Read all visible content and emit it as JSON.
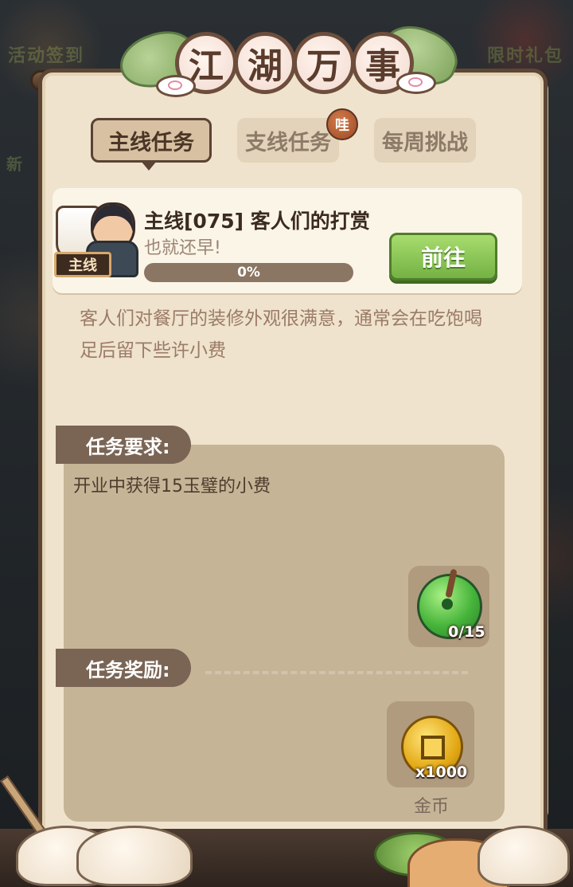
{
  "background": {
    "left_label_1": "活动签到",
    "left_label_2": "新",
    "right_label": "限时礼包"
  },
  "title": {
    "chars": [
      "江",
      "湖",
      "万",
      "事"
    ]
  },
  "tabs": [
    {
      "label": "主线任务",
      "active": true
    },
    {
      "label": "支线任务",
      "active": false,
      "badge": "哇"
    },
    {
      "label": "每周挑战",
      "active": false
    }
  ],
  "quest": {
    "tag": "主线",
    "title": "主线[075] 客人们的打赏",
    "subtitle": "也就还早!",
    "progress": 0,
    "progress_text": "0%",
    "go_button": "前往",
    "description": "客人们对餐厅的装修外观很满意，通常会在吃饱喝足后留下些许小费"
  },
  "requirement": {
    "header": "任务要求:",
    "text": "开业中获得15玉璧的小费",
    "item_icon": "jade-bi-icon",
    "count": "0/15"
  },
  "reward": {
    "header": "任务奖励:",
    "item_icon": "gold-coin-icon",
    "count": "x1000",
    "label": "金币"
  },
  "colors": {
    "panel": "#efe3cd",
    "accent_green": "#8fcf55",
    "section_tab": "#7a6555",
    "border": "#5e4634"
  }
}
